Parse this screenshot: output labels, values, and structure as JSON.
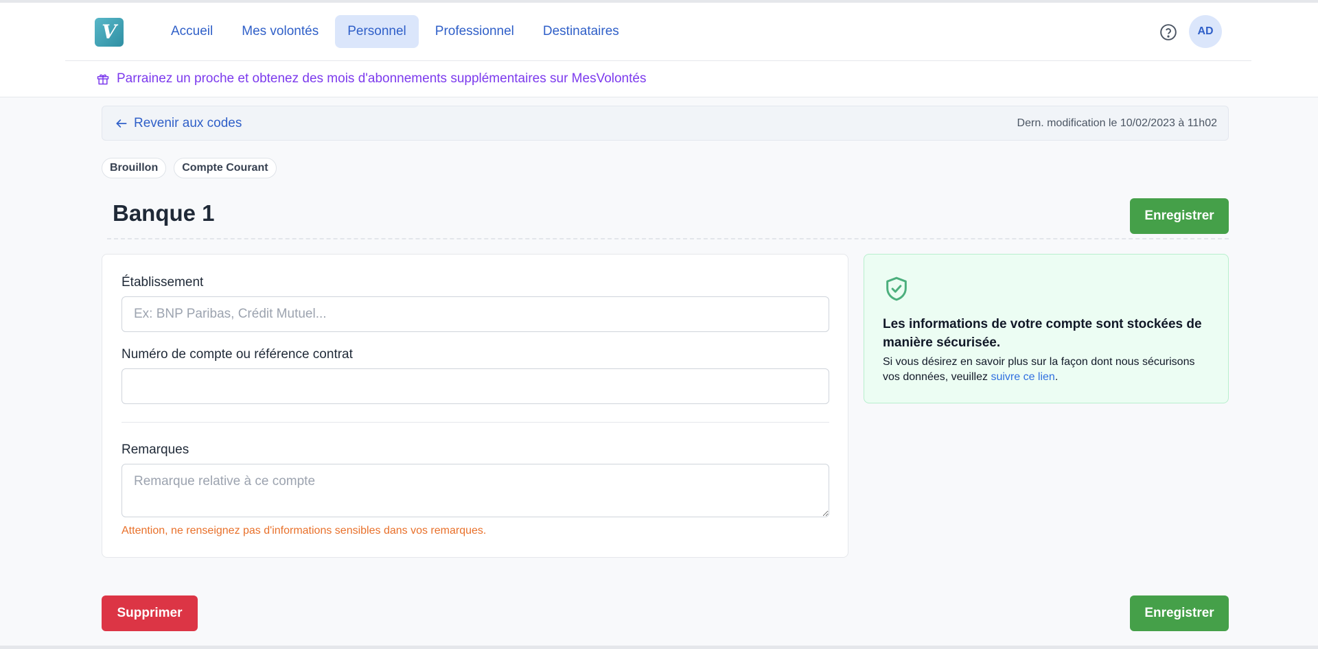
{
  "nav": {
    "logo_letter": "V",
    "links": [
      {
        "label": "Accueil",
        "active": false
      },
      {
        "label": "Mes volontés",
        "active": false
      },
      {
        "label": "Personnel",
        "active": true
      },
      {
        "label": "Professionnel",
        "active": false
      },
      {
        "label": "Destinataires",
        "active": false
      }
    ],
    "avatar_initials": "AD",
    "help_icon": "question-circle-icon"
  },
  "promo": {
    "icon": "gift-icon",
    "text": "Parrainez un proche et obtenez des mois d'abonnements supplémentaires sur MesVolontés"
  },
  "backbar": {
    "back_label": "Revenir aux codes",
    "last_modified": "Dern. modification le 10/02/2023 à 11h02"
  },
  "badges": [
    "Brouillon",
    "Compte Courant"
  ],
  "page": {
    "title": "Banque 1",
    "save_label": "Enregistrer",
    "delete_label": "Supprimer"
  },
  "form": {
    "etablissement": {
      "label": "Établissement",
      "value": "",
      "placeholder": "Ex: BNP Paribas, Crédit Mutuel..."
    },
    "numero": {
      "label": "Numéro de compte ou référence contrat",
      "value": "",
      "placeholder": ""
    },
    "remarques": {
      "label": "Remarques",
      "value": "",
      "placeholder": "Remarque relative à ce compte"
    },
    "warning": "Attention, ne renseignez pas d'informations sensibles dans vos remarques."
  },
  "info": {
    "icon": "shield-check-icon",
    "title": "Les informations de votre compte sont stockées de manière sécurisée.",
    "text_before": "Si vous désirez en savoir plus sur la façon dont nous sécurisons vos données, veuillez ",
    "link_label": "suivre ce lien",
    "text_after": "."
  },
  "colors": {
    "primary": "#2f5fc8",
    "success": "#45a049",
    "danger": "#dc3545",
    "promo": "#7c3aed",
    "warning": "#e8702a"
  }
}
